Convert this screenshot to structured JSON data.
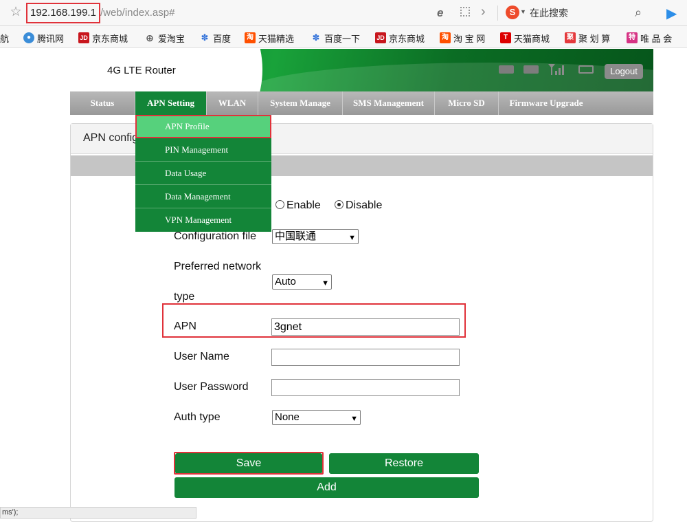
{
  "browser": {
    "url_host": "192.168.199.1",
    "url_path": "/web/index.asp#",
    "search_label": "在此搜索",
    "bookmarks": [
      {
        "label": "航",
        "icon": "none"
      },
      {
        "label": "腾讯网",
        "icon": "tencent-icon"
      },
      {
        "label": "京东商城",
        "icon": "jd-icon"
      },
      {
        "label": "爱淘宝",
        "icon": "globe-icon"
      },
      {
        "label": "百度",
        "icon": "baidu-paw-icon"
      },
      {
        "label": "天猫精选",
        "icon": "tmall-icon"
      },
      {
        "label": "百度一下",
        "icon": "baidu-paw-icon"
      },
      {
        "label": "京东商城",
        "icon": "jd-icon"
      },
      {
        "label": "淘 宝 网",
        "icon": "taobao-icon"
      },
      {
        "label": "天猫商城",
        "icon": "tmall-t-icon"
      },
      {
        "label": "聚 划 算",
        "icon": "juhuasuan-icon"
      },
      {
        "label": "唯 品 会",
        "icon": "vip-icon"
      }
    ],
    "status_tip": "ms');"
  },
  "router": {
    "brand": "4G LTE Router",
    "logout_label": "Logout",
    "menu_tabs": [
      "Status",
      "APN Setting",
      "WLAN",
      "System Manage",
      "SMS Management",
      "Micro SD",
      "Firmware Upgrade"
    ],
    "active_tab": "APN Setting",
    "submenu": [
      "APN Profile",
      "PIN Management",
      "Data Usage",
      "Data Management",
      "VPN Management"
    ],
    "highlighted_submenu": "APN Profile",
    "panel_title": "APN config",
    "form": {
      "enable_label": "Enable",
      "disable_label": "Disable",
      "selected_mode": "Disable",
      "config_file_label": "Configuration file",
      "config_file_value": "中国联通",
      "network_type_label_1": "Preferred network",
      "network_type_label_2": "type",
      "network_type_value": "Auto",
      "apn_label": "APN",
      "apn_value": "3gnet",
      "username_label": "User Name",
      "username_value": "",
      "password_label": "User Password",
      "password_value": "",
      "auth_label": "Auth type",
      "auth_value": "None"
    },
    "buttons": {
      "save": "Save",
      "restore": "Restore",
      "add": "Add"
    }
  },
  "colors": {
    "router_green": "#138538",
    "submenu_highlight": "#56d17c",
    "annotation_red": "#e0323a"
  }
}
